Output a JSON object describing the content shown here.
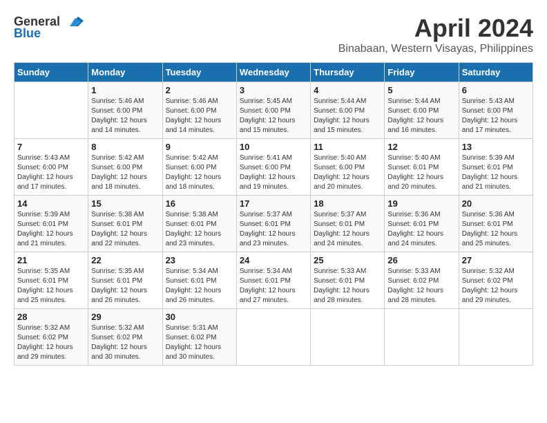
{
  "header": {
    "logo_general": "General",
    "logo_blue": "Blue",
    "month_year": "April 2024",
    "location": "Binabaan, Western Visayas, Philippines"
  },
  "days_of_week": [
    "Sunday",
    "Monday",
    "Tuesday",
    "Wednesday",
    "Thursday",
    "Friday",
    "Saturday"
  ],
  "weeks": [
    [
      {
        "day": "",
        "info": ""
      },
      {
        "day": "1",
        "info": "Sunrise: 5:46 AM\nSunset: 6:00 PM\nDaylight: 12 hours\nand 14 minutes."
      },
      {
        "day": "2",
        "info": "Sunrise: 5:46 AM\nSunset: 6:00 PM\nDaylight: 12 hours\nand 14 minutes."
      },
      {
        "day": "3",
        "info": "Sunrise: 5:45 AM\nSunset: 6:00 PM\nDaylight: 12 hours\nand 15 minutes."
      },
      {
        "day": "4",
        "info": "Sunrise: 5:44 AM\nSunset: 6:00 PM\nDaylight: 12 hours\nand 15 minutes."
      },
      {
        "day": "5",
        "info": "Sunrise: 5:44 AM\nSunset: 6:00 PM\nDaylight: 12 hours\nand 16 minutes."
      },
      {
        "day": "6",
        "info": "Sunrise: 5:43 AM\nSunset: 6:00 PM\nDaylight: 12 hours\nand 17 minutes."
      }
    ],
    [
      {
        "day": "7",
        "info": "Sunrise: 5:43 AM\nSunset: 6:00 PM\nDaylight: 12 hours\nand 17 minutes."
      },
      {
        "day": "8",
        "info": "Sunrise: 5:42 AM\nSunset: 6:00 PM\nDaylight: 12 hours\nand 18 minutes."
      },
      {
        "day": "9",
        "info": "Sunrise: 5:42 AM\nSunset: 6:00 PM\nDaylight: 12 hours\nand 18 minutes."
      },
      {
        "day": "10",
        "info": "Sunrise: 5:41 AM\nSunset: 6:00 PM\nDaylight: 12 hours\nand 19 minutes."
      },
      {
        "day": "11",
        "info": "Sunrise: 5:40 AM\nSunset: 6:00 PM\nDaylight: 12 hours\nand 20 minutes."
      },
      {
        "day": "12",
        "info": "Sunrise: 5:40 AM\nSunset: 6:01 PM\nDaylight: 12 hours\nand 20 minutes."
      },
      {
        "day": "13",
        "info": "Sunrise: 5:39 AM\nSunset: 6:01 PM\nDaylight: 12 hours\nand 21 minutes."
      }
    ],
    [
      {
        "day": "14",
        "info": "Sunrise: 5:39 AM\nSunset: 6:01 PM\nDaylight: 12 hours\nand 21 minutes."
      },
      {
        "day": "15",
        "info": "Sunrise: 5:38 AM\nSunset: 6:01 PM\nDaylight: 12 hours\nand 22 minutes."
      },
      {
        "day": "16",
        "info": "Sunrise: 5:38 AM\nSunset: 6:01 PM\nDaylight: 12 hours\nand 23 minutes."
      },
      {
        "day": "17",
        "info": "Sunrise: 5:37 AM\nSunset: 6:01 PM\nDaylight: 12 hours\nand 23 minutes."
      },
      {
        "day": "18",
        "info": "Sunrise: 5:37 AM\nSunset: 6:01 PM\nDaylight: 12 hours\nand 24 minutes."
      },
      {
        "day": "19",
        "info": "Sunrise: 5:36 AM\nSunset: 6:01 PM\nDaylight: 12 hours\nand 24 minutes."
      },
      {
        "day": "20",
        "info": "Sunrise: 5:36 AM\nSunset: 6:01 PM\nDaylight: 12 hours\nand 25 minutes."
      }
    ],
    [
      {
        "day": "21",
        "info": "Sunrise: 5:35 AM\nSunset: 6:01 PM\nDaylight: 12 hours\nand 25 minutes."
      },
      {
        "day": "22",
        "info": "Sunrise: 5:35 AM\nSunset: 6:01 PM\nDaylight: 12 hours\nand 26 minutes."
      },
      {
        "day": "23",
        "info": "Sunrise: 5:34 AM\nSunset: 6:01 PM\nDaylight: 12 hours\nand 26 minutes."
      },
      {
        "day": "24",
        "info": "Sunrise: 5:34 AM\nSunset: 6:01 PM\nDaylight: 12 hours\nand 27 minutes."
      },
      {
        "day": "25",
        "info": "Sunrise: 5:33 AM\nSunset: 6:01 PM\nDaylight: 12 hours\nand 28 minutes."
      },
      {
        "day": "26",
        "info": "Sunrise: 5:33 AM\nSunset: 6:02 PM\nDaylight: 12 hours\nand 28 minutes."
      },
      {
        "day": "27",
        "info": "Sunrise: 5:32 AM\nSunset: 6:02 PM\nDaylight: 12 hours\nand 29 minutes."
      }
    ],
    [
      {
        "day": "28",
        "info": "Sunrise: 5:32 AM\nSunset: 6:02 PM\nDaylight: 12 hours\nand 29 minutes."
      },
      {
        "day": "29",
        "info": "Sunrise: 5:32 AM\nSunset: 6:02 PM\nDaylight: 12 hours\nand 30 minutes."
      },
      {
        "day": "30",
        "info": "Sunrise: 5:31 AM\nSunset: 6:02 PM\nDaylight: 12 hours\nand 30 minutes."
      },
      {
        "day": "",
        "info": ""
      },
      {
        "day": "",
        "info": ""
      },
      {
        "day": "",
        "info": ""
      },
      {
        "day": "",
        "info": ""
      }
    ]
  ]
}
